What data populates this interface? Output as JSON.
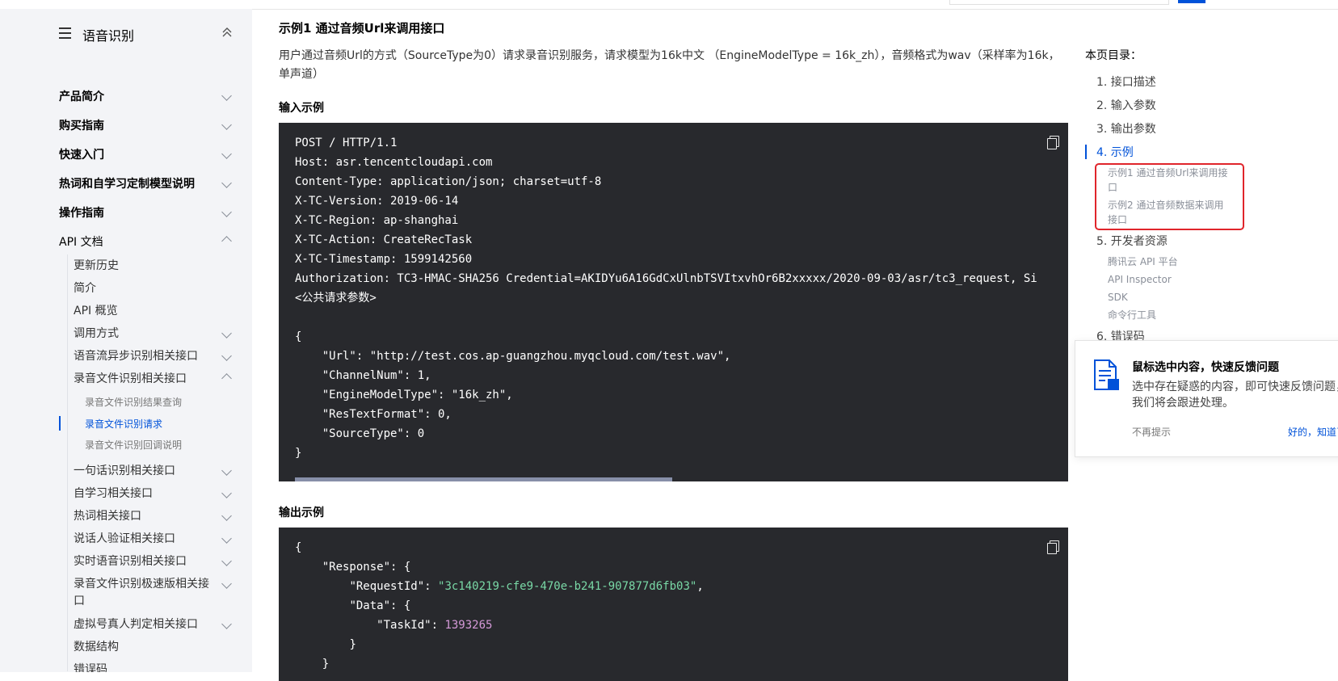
{
  "sidebar": {
    "title": "语音识别",
    "top_items": [
      {
        "label": "产品简介"
      },
      {
        "label": "购买指南"
      },
      {
        "label": "快速入门"
      },
      {
        "label": "热词和自学习定制模型说明"
      },
      {
        "label": "操作指南"
      },
      {
        "label": "API 文档"
      }
    ],
    "api_items": [
      {
        "label": "更新历史"
      },
      {
        "label": "简介"
      },
      {
        "label": "API 概览"
      },
      {
        "label": "调用方式"
      },
      {
        "label": "语音流异步识别相关接口"
      },
      {
        "label": "录音文件识别相关接口"
      }
    ],
    "file_sub_items": [
      {
        "label": "录音文件识别结果查询"
      },
      {
        "label": "录音文件识别请求"
      },
      {
        "label": "录音文件识别回调说明"
      }
    ],
    "more_items": [
      {
        "label": "一句话识别相关接口"
      },
      {
        "label": "自学习相关接口"
      },
      {
        "label": "热词相关接口"
      },
      {
        "label": "说话人验证相关接口"
      },
      {
        "label": "实时语音识别相关接口"
      },
      {
        "label": "录音文件识别极速版相关接口"
      },
      {
        "label": "虚拟号真人判定相关接口"
      },
      {
        "label": "数据结构"
      },
      {
        "label": "错误码"
      }
    ]
  },
  "main": {
    "example_title": "示例1 通过音频Url来调用接口",
    "description": "用户通过音频Url的方式（SourceType为0）请求录音识别服务，请求模型为16k中文 （EngineModelType = 16k_zh），音频格式为wav（采样率为16k，单声道）",
    "input_label": "输入示例",
    "input_code": "POST / HTTP/1.1\nHost: asr.tencentcloudapi.com\nContent-Type: application/json; charset=utf-8\nX-TC-Version: 2019-06-14\nX-TC-Region: ap-shanghai\nX-TC-Action: CreateRecTask\nX-TC-Timestamp: 1599142560\nAuthorization: TC3-HMAC-SHA256 Credential=AKIDYu6A16GdCxUlnbTSVItxvhOr6B2xxxxx/2020-09-03/asr/tc3_request, Si\n<公共请求参数>\n\n{\n    \"Url\": \"http://test.cos.ap-guangzhou.myqcloud.com/test.wav\",\n    \"ChannelNum\": 1,\n    \"EngineModelType\": \"16k_zh\",\n    \"ResTextFormat\": 0,\n    \"SourceType\": 0\n}",
    "output_label": "输出示例",
    "output": {
      "open": "{",
      "response_key": "\"Response\"",
      "request_id_key": "\"RequestId\"",
      "request_id_value": "\"3c140219-cfe9-470e-b241-907877d6fb03\"",
      "data_key": "\"Data\"",
      "task_id_key": "\"TaskId\"",
      "task_id_value": "1393265",
      "close_inner": "}",
      "close_outer": "}"
    }
  },
  "toc": {
    "title": "本页目录：",
    "items": [
      {
        "label": "1. 接口描述"
      },
      {
        "label": "2. 输入参数"
      },
      {
        "label": "3. 输出参数"
      },
      {
        "label": "4. 示例"
      },
      {
        "label": "5. 开发者资源"
      },
      {
        "label": "6. 错误码"
      }
    ],
    "example_subs": [
      {
        "label": "示例1 通过音频Url来调用接口"
      },
      {
        "label": "示例2 通过音频数据来调用接口"
      }
    ],
    "dev_subs": [
      {
        "label": "腾讯云 API 平台"
      },
      {
        "label": "API Inspector"
      },
      {
        "label": "SDK"
      },
      {
        "label": "命令行工具"
      }
    ]
  },
  "popup": {
    "title": "鼠标选中内容，快速反馈问题",
    "body": "选中存在疑惑的内容，即可快速反馈问题，\n我们将会跟进处理。",
    "dismiss_label": "不再提示",
    "ok_label": "好的，知道了"
  },
  "colors": {
    "accent": "#0052d9",
    "code_bg": "#28292d",
    "highlight_border": "#e0252b",
    "sidebar_bg": "#f3f4f7"
  }
}
